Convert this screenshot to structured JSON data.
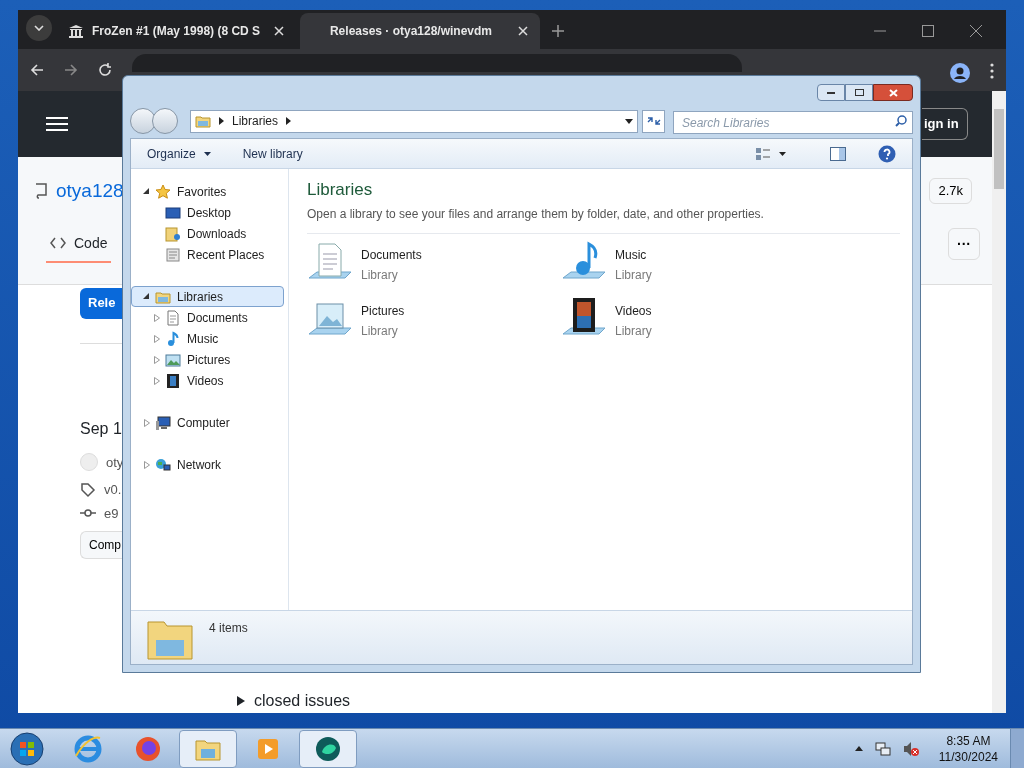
{
  "browser": {
    "tabs": [
      {
        "title": "FroZen #1 (May 1998) (8 CD S",
        "selected": false
      },
      {
        "title": "Releases · otya128/winevdm",
        "selected": true
      }
    ],
    "page": {
      "sign_in": "ign in",
      "repo": "otya128",
      "repo_tab": "Code",
      "stars": "2.7k",
      "more": "···",
      "releases_button": "Rele",
      "date": "Sep 1",
      "author": "oty",
      "tag": "v0.",
      "commit": "e9",
      "compare": "Comp",
      "closed_issues": "closed issues"
    }
  },
  "explorer": {
    "address": "Libraries",
    "search": {
      "placeholder": "Search Libraries"
    },
    "toolbar": {
      "organize": "Organize",
      "new_library": "New library"
    },
    "nav": [
      {
        "label": "Favorites",
        "kind": "star",
        "expanded": true,
        "selected": false,
        "children": [
          {
            "label": "Desktop",
            "kind": "desktop",
            "selected": false
          },
          {
            "label": "Downloads",
            "kind": "downloads",
            "selected": false
          },
          {
            "label": "Recent Places",
            "kind": "recent",
            "selected": false
          }
        ]
      },
      {
        "label": "Libraries",
        "kind": "library",
        "expanded": true,
        "selected": true,
        "children": [
          {
            "label": "Documents",
            "kind": "documents",
            "expanded": false,
            "selected": false
          },
          {
            "label": "Music",
            "kind": "music",
            "expanded": false,
            "selected": false
          },
          {
            "label": "Pictures",
            "kind": "pictures",
            "expanded": false,
            "selected": false
          },
          {
            "label": "Videos",
            "kind": "videos",
            "expanded": false,
            "selected": false
          }
        ]
      },
      {
        "label": "Computer",
        "kind": "computer",
        "expanded": false,
        "selected": false
      },
      {
        "label": "Network",
        "kind": "network",
        "expanded": false,
        "selected": false
      }
    ],
    "heading": "Libraries",
    "description": "Open a library to see your files and arrange them by folder, date, and other properties.",
    "items": [
      {
        "name": "Documents",
        "type": "Library",
        "kind": "documents"
      },
      {
        "name": "Music",
        "type": "Library",
        "kind": "music"
      },
      {
        "name": "Pictures",
        "type": "Library",
        "kind": "pictures"
      },
      {
        "name": "Videos",
        "type": "Library",
        "kind": "videos"
      }
    ],
    "status": "4 items"
  },
  "taskbar": {
    "apps": [
      {
        "kind": "ie",
        "active": false
      },
      {
        "kind": "firefox",
        "active": false
      },
      {
        "kind": "explorer",
        "active": true
      },
      {
        "kind": "media",
        "active": false
      },
      {
        "kind": "orb",
        "active": true
      }
    ],
    "time": "8:35 AM",
    "date": "11/30/2024"
  }
}
